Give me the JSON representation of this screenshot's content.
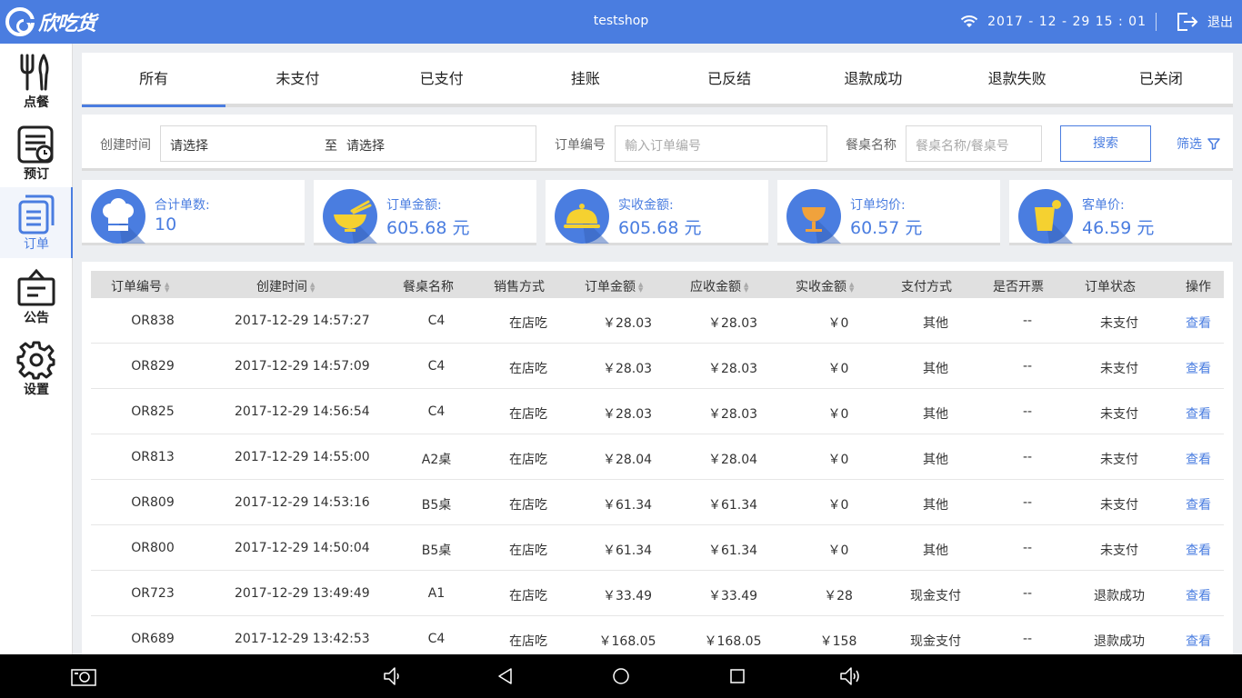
{
  "app": {
    "logo_text": "欣吃货",
    "shop_name": "testshop",
    "datetime": "2017 - 12 - 29  15 : 01",
    "logout_label": "退出"
  },
  "sidebar": {
    "items": [
      {
        "label": "点餐",
        "icon": "fork-knife-icon"
      },
      {
        "label": "预订",
        "icon": "reservation-clock-icon"
      },
      {
        "label": "订单",
        "icon": "orders-icon"
      },
      {
        "label": "公告",
        "icon": "notice-board-icon"
      },
      {
        "label": "设置",
        "icon": "gear-icon"
      }
    ],
    "active": "订单"
  },
  "tabs": [
    "所有",
    "未支付",
    "已支付",
    "挂账",
    "已反结",
    "退款成功",
    "退款失败",
    "已关闭"
  ],
  "filters": {
    "created_label": "创建时间",
    "start_value": "请选择",
    "to_label": "至",
    "end_value": "请选择",
    "order_no_label": "订单编号",
    "order_no_placeholder": "輸入订单编号",
    "table_label": "餐桌名称",
    "table_placeholder": "餐桌名称/餐桌号",
    "search_label": "搜索",
    "filter_label": "筛选"
  },
  "stats": [
    {
      "label": "合计单数:",
      "value": "10",
      "icon": "chef-hat-icon",
      "color": "#4a7de0"
    },
    {
      "label": "订单金额:",
      "value": "605.68 元",
      "icon": "bowl-chopsticks-icon",
      "color": "#4a7de0"
    },
    {
      "label": "实收金额:",
      "value": "605.68 元",
      "icon": "food-cloche-icon",
      "color": "#4a7de0"
    },
    {
      "label": "订单均价:",
      "value": "60.57 元",
      "icon": "goblet-icon",
      "color": "#4a7de0"
    },
    {
      "label": "客单价:",
      "value": "46.59 元",
      "icon": "drink-cup-icon",
      "color": "#4a7de0"
    }
  ],
  "table": {
    "columns": [
      "订单编号",
      "创建时间",
      "餐桌名称",
      "销售方式",
      "订单金额",
      "应收金额",
      "实收金额",
      "支付方式",
      "是否开票",
      "订单状态",
      "操作"
    ],
    "rows": [
      [
        "OR838",
        "2017-12-29 14:57:27",
        "C4",
        "在店吃",
        "￥28.03",
        "￥28.03",
        "￥0",
        "其他",
        "--",
        "未支付",
        "查看"
      ],
      [
        "OR829",
        "2017-12-29 14:57:09",
        "C4",
        "在店吃",
        "￥28.03",
        "￥28.03",
        "￥0",
        "其他",
        "--",
        "未支付",
        "查看"
      ],
      [
        "OR825",
        "2017-12-29 14:56:54",
        "C4",
        "在店吃",
        "￥28.03",
        "￥28.03",
        "￥0",
        "其他",
        "--",
        "未支付",
        "查看"
      ],
      [
        "OR813",
        "2017-12-29 14:55:00",
        "A2桌",
        "在店吃",
        "￥28.04",
        "￥28.04",
        "￥0",
        "其他",
        "--",
        "未支付",
        "查看"
      ],
      [
        "OR809",
        "2017-12-29 14:53:16",
        "B5桌",
        "在店吃",
        "￥61.34",
        "￥61.34",
        "￥0",
        "其他",
        "--",
        "未支付",
        "查看"
      ],
      [
        "OR800",
        "2017-12-29 14:50:04",
        "B5桌",
        "在店吃",
        "￥61.34",
        "￥61.34",
        "￥0",
        "其他",
        "--",
        "未支付",
        "查看"
      ],
      [
        "OR723",
        "2017-12-29 13:49:49",
        "A1",
        "在店吃",
        "￥33.49",
        "￥33.49",
        "￥28",
        "现金支付",
        "--",
        "退款成功",
        "查看"
      ],
      [
        "OR689",
        "2017-12-29 13:42:53",
        "C4",
        "在店吃",
        "￥168.05",
        "￥168.05",
        "￥158",
        "现金支付",
        "--",
        "退款成功",
        "查看"
      ]
    ]
  },
  "navbar": [
    "screenshot-icon",
    "volume-down-icon",
    "back-icon",
    "home-icon",
    "recents-icon",
    "volume-up-icon"
  ],
  "colors": {
    "primary": "#4a7de0",
    "accent_yellow": "#f5d130",
    "accent_orange": "#f0a23c"
  }
}
